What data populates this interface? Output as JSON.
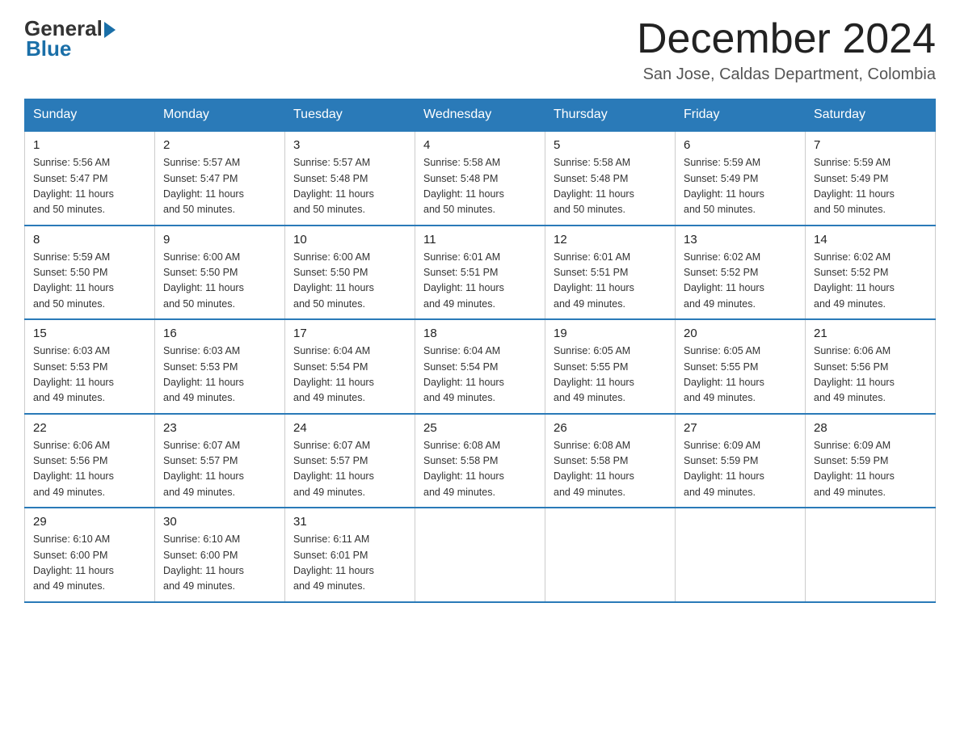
{
  "logo": {
    "general": "General",
    "blue": "Blue"
  },
  "header": {
    "month_title": "December 2024",
    "location": "San Jose, Caldas Department, Colombia"
  },
  "weekdays": [
    "Sunday",
    "Monday",
    "Tuesday",
    "Wednesday",
    "Thursday",
    "Friday",
    "Saturday"
  ],
  "weeks": [
    [
      {
        "day": "1",
        "sunrise": "5:56 AM",
        "sunset": "5:47 PM",
        "daylight": "11 hours and 50 minutes."
      },
      {
        "day": "2",
        "sunrise": "5:57 AM",
        "sunset": "5:47 PM",
        "daylight": "11 hours and 50 minutes."
      },
      {
        "day": "3",
        "sunrise": "5:57 AM",
        "sunset": "5:48 PM",
        "daylight": "11 hours and 50 minutes."
      },
      {
        "day": "4",
        "sunrise": "5:58 AM",
        "sunset": "5:48 PM",
        "daylight": "11 hours and 50 minutes."
      },
      {
        "day": "5",
        "sunrise": "5:58 AM",
        "sunset": "5:48 PM",
        "daylight": "11 hours and 50 minutes."
      },
      {
        "day": "6",
        "sunrise": "5:59 AM",
        "sunset": "5:49 PM",
        "daylight": "11 hours and 50 minutes."
      },
      {
        "day": "7",
        "sunrise": "5:59 AM",
        "sunset": "5:49 PM",
        "daylight": "11 hours and 50 minutes."
      }
    ],
    [
      {
        "day": "8",
        "sunrise": "5:59 AM",
        "sunset": "5:50 PM",
        "daylight": "11 hours and 50 minutes."
      },
      {
        "day": "9",
        "sunrise": "6:00 AM",
        "sunset": "5:50 PM",
        "daylight": "11 hours and 50 minutes."
      },
      {
        "day": "10",
        "sunrise": "6:00 AM",
        "sunset": "5:50 PM",
        "daylight": "11 hours and 50 minutes."
      },
      {
        "day": "11",
        "sunrise": "6:01 AM",
        "sunset": "5:51 PM",
        "daylight": "11 hours and 49 minutes."
      },
      {
        "day": "12",
        "sunrise": "6:01 AM",
        "sunset": "5:51 PM",
        "daylight": "11 hours and 49 minutes."
      },
      {
        "day": "13",
        "sunrise": "6:02 AM",
        "sunset": "5:52 PM",
        "daylight": "11 hours and 49 minutes."
      },
      {
        "day": "14",
        "sunrise": "6:02 AM",
        "sunset": "5:52 PM",
        "daylight": "11 hours and 49 minutes."
      }
    ],
    [
      {
        "day": "15",
        "sunrise": "6:03 AM",
        "sunset": "5:53 PM",
        "daylight": "11 hours and 49 minutes."
      },
      {
        "day": "16",
        "sunrise": "6:03 AM",
        "sunset": "5:53 PM",
        "daylight": "11 hours and 49 minutes."
      },
      {
        "day": "17",
        "sunrise": "6:04 AM",
        "sunset": "5:54 PM",
        "daylight": "11 hours and 49 minutes."
      },
      {
        "day": "18",
        "sunrise": "6:04 AM",
        "sunset": "5:54 PM",
        "daylight": "11 hours and 49 minutes."
      },
      {
        "day": "19",
        "sunrise": "6:05 AM",
        "sunset": "5:55 PM",
        "daylight": "11 hours and 49 minutes."
      },
      {
        "day": "20",
        "sunrise": "6:05 AM",
        "sunset": "5:55 PM",
        "daylight": "11 hours and 49 minutes."
      },
      {
        "day": "21",
        "sunrise": "6:06 AM",
        "sunset": "5:56 PM",
        "daylight": "11 hours and 49 minutes."
      }
    ],
    [
      {
        "day": "22",
        "sunrise": "6:06 AM",
        "sunset": "5:56 PM",
        "daylight": "11 hours and 49 minutes."
      },
      {
        "day": "23",
        "sunrise": "6:07 AM",
        "sunset": "5:57 PM",
        "daylight": "11 hours and 49 minutes."
      },
      {
        "day": "24",
        "sunrise": "6:07 AM",
        "sunset": "5:57 PM",
        "daylight": "11 hours and 49 minutes."
      },
      {
        "day": "25",
        "sunrise": "6:08 AM",
        "sunset": "5:58 PM",
        "daylight": "11 hours and 49 minutes."
      },
      {
        "day": "26",
        "sunrise": "6:08 AM",
        "sunset": "5:58 PM",
        "daylight": "11 hours and 49 minutes."
      },
      {
        "day": "27",
        "sunrise": "6:09 AM",
        "sunset": "5:59 PM",
        "daylight": "11 hours and 49 minutes."
      },
      {
        "day": "28",
        "sunrise": "6:09 AM",
        "sunset": "5:59 PM",
        "daylight": "11 hours and 49 minutes."
      }
    ],
    [
      {
        "day": "29",
        "sunrise": "6:10 AM",
        "sunset": "6:00 PM",
        "daylight": "11 hours and 49 minutes."
      },
      {
        "day": "30",
        "sunrise": "6:10 AM",
        "sunset": "6:00 PM",
        "daylight": "11 hours and 49 minutes."
      },
      {
        "day": "31",
        "sunrise": "6:11 AM",
        "sunset": "6:01 PM",
        "daylight": "11 hours and 49 minutes."
      },
      null,
      null,
      null,
      null
    ]
  ],
  "labels": {
    "sunrise": "Sunrise:",
    "sunset": "Sunset:",
    "daylight": "Daylight:"
  }
}
